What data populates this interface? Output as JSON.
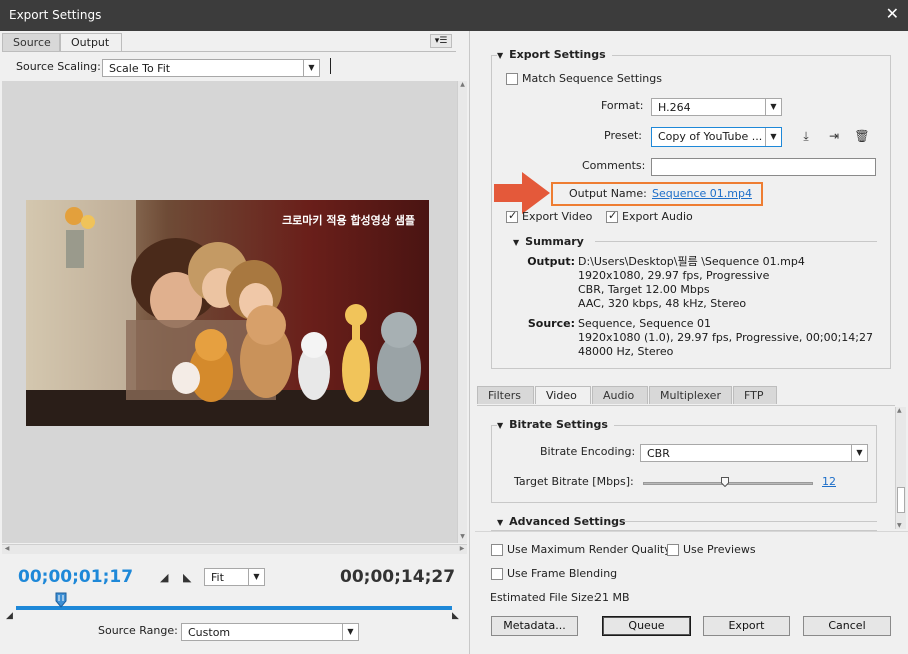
{
  "window": {
    "title": "Export Settings",
    "close_glyph": "✕"
  },
  "left": {
    "tabs": [
      {
        "label": "Source",
        "active": false
      },
      {
        "label": "Output",
        "active": true
      }
    ],
    "panel_menu_icon": "panel-menu-icon",
    "source_scaling": {
      "label": "Source Scaling:",
      "value": "Scale To Fit"
    },
    "video_caption": "크로마키 적용 합성영상 샘플",
    "timecode_current": "00;00;01;17",
    "timecode_duration": "00;00;14;27",
    "fit_select": "Fit",
    "source_range": {
      "label": "Source Range:",
      "value": "Custom"
    }
  },
  "export_settings": {
    "title": "Export Settings",
    "match_sequence": "Match Sequence Settings",
    "format_label": "Format:",
    "format_value": "H.264",
    "preset_label": "Preset:",
    "preset_value": "Copy of YouTube ...",
    "comments_label": "Comments:",
    "comments_value": "",
    "output_name_label": "Output Name:",
    "output_name_value": "Sequence 01.mp4",
    "export_video": "Export Video",
    "export_audio": "Export Audio"
  },
  "summary": {
    "title": "Summary",
    "output_label": "Output:",
    "output_lines": [
      "D:\\Users\\Desktop\\필름 \\Sequence 01.mp4",
      "1920x1080, 29.97 fps, Progressive",
      "CBR, Target 12.00 Mbps",
      "AAC, 320 kbps, 48 kHz, Stereo"
    ],
    "source_label": "Source:",
    "source_lines": [
      "Sequence, Sequence 01",
      "1920x1080 (1.0), 29.97 fps, Progressive, 00;00;14;27",
      "48000 Hz, Stereo"
    ]
  },
  "settings_tabs": [
    {
      "label": "Filters",
      "active": false
    },
    {
      "label": "Video",
      "active": true
    },
    {
      "label": "Audio",
      "active": false
    },
    {
      "label": "Multiplexer",
      "active": false
    },
    {
      "label": "FTP",
      "active": false
    }
  ],
  "bitrate": {
    "title": "Bitrate Settings",
    "encoding_label": "Bitrate Encoding:",
    "encoding_value": "CBR",
    "target_label": "Target Bitrate [Mbps]:",
    "target_value": "12",
    "target_fraction": 0.48
  },
  "advanced": {
    "title": "Advanced Settings"
  },
  "bottom": {
    "max_render": "Use Maximum Render Quality",
    "use_previews": "Use Previews",
    "frame_blending": "Use Frame Blending",
    "file_size_label": "Estimated File Size:",
    "file_size_value": "21 MB"
  },
  "buttons": {
    "metadata": "Metadata...",
    "queue": "Queue",
    "export": "Export",
    "cancel": "Cancel"
  },
  "colors": {
    "accent": "#1e88d8",
    "highlight": "#ee7d32",
    "link": "#1e6fc9"
  }
}
